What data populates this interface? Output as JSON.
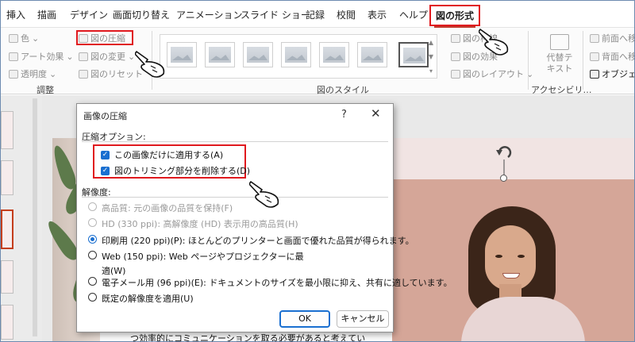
{
  "tabs": {
    "insert": "挿入",
    "draw": "描画",
    "design": "デザイン",
    "transitions": "画面切り替え",
    "animations": "アニメーション",
    "slideshow": "スライド ショー",
    "record": "記録",
    "review": "校閲",
    "view": "表示",
    "help": "ヘルプ",
    "picture_format": "図の形式"
  },
  "ribbon": {
    "color": "色",
    "artistic_effects": "アート効果",
    "transparency": "透明度",
    "compress_pictures": "図の圧縮",
    "change_picture": "図の変更",
    "reset_picture": "図のリセット",
    "adjust_group": "調整",
    "picture_border": "図の枠線",
    "picture_effects": "図の効果",
    "picture_layout": "図のレイアウト",
    "styles_group": "図のスタイル",
    "alt_text_line1": "代替テ",
    "alt_text_line2": "キスト",
    "accessibility_group": "アクセシビリ…",
    "bring_forward": "前面へ移",
    "send_backward": "背面へ移",
    "selection_pane": "オブジェク"
  },
  "dialog": {
    "title": "画像の圧縮",
    "help": "?",
    "close": "✕",
    "compression_options_label": "圧縮オプション:",
    "apply_only_this": "この画像だけに適用する(A)",
    "delete_cropped": "図のトリミング部分を削除する(D)",
    "resolution_label": "解像度:",
    "options": [
      {
        "label": "高品質: 元の画像の品質を保持(F)",
        "disabled": true,
        "checked": false
      },
      {
        "label": "HD (330 ppi): 高解像度 (HD) 表示用の高品質(H)",
        "disabled": true,
        "checked": false
      },
      {
        "label": "印刷用 (220 ppi)(P): ほとんどのプリンターと画面で優れた品質が得られます。",
        "disabled": false,
        "checked": true
      },
      {
        "label": "Web (150 ppi): Web ページやプロジェクターに最",
        "label2": "適(W)",
        "disabled": false,
        "checked": false
      },
      {
        "label": "電子メール用 (96 ppi)(E): ドキュメントのサイズを最小限に抑え、共有に適しています。",
        "disabled": false,
        "checked": false
      },
      {
        "label": "既定の解像度を適用(U)",
        "disabled": false,
        "checked": false
      }
    ],
    "ok": "OK",
    "cancel": "キャンセル"
  },
  "slide": {
    "caption": "つ効率的にコミュニケーションを取る必要があると考えてい"
  },
  "colors": {
    "accent_red": "#e0191e",
    "accent_blue": "#1a6fd0"
  }
}
